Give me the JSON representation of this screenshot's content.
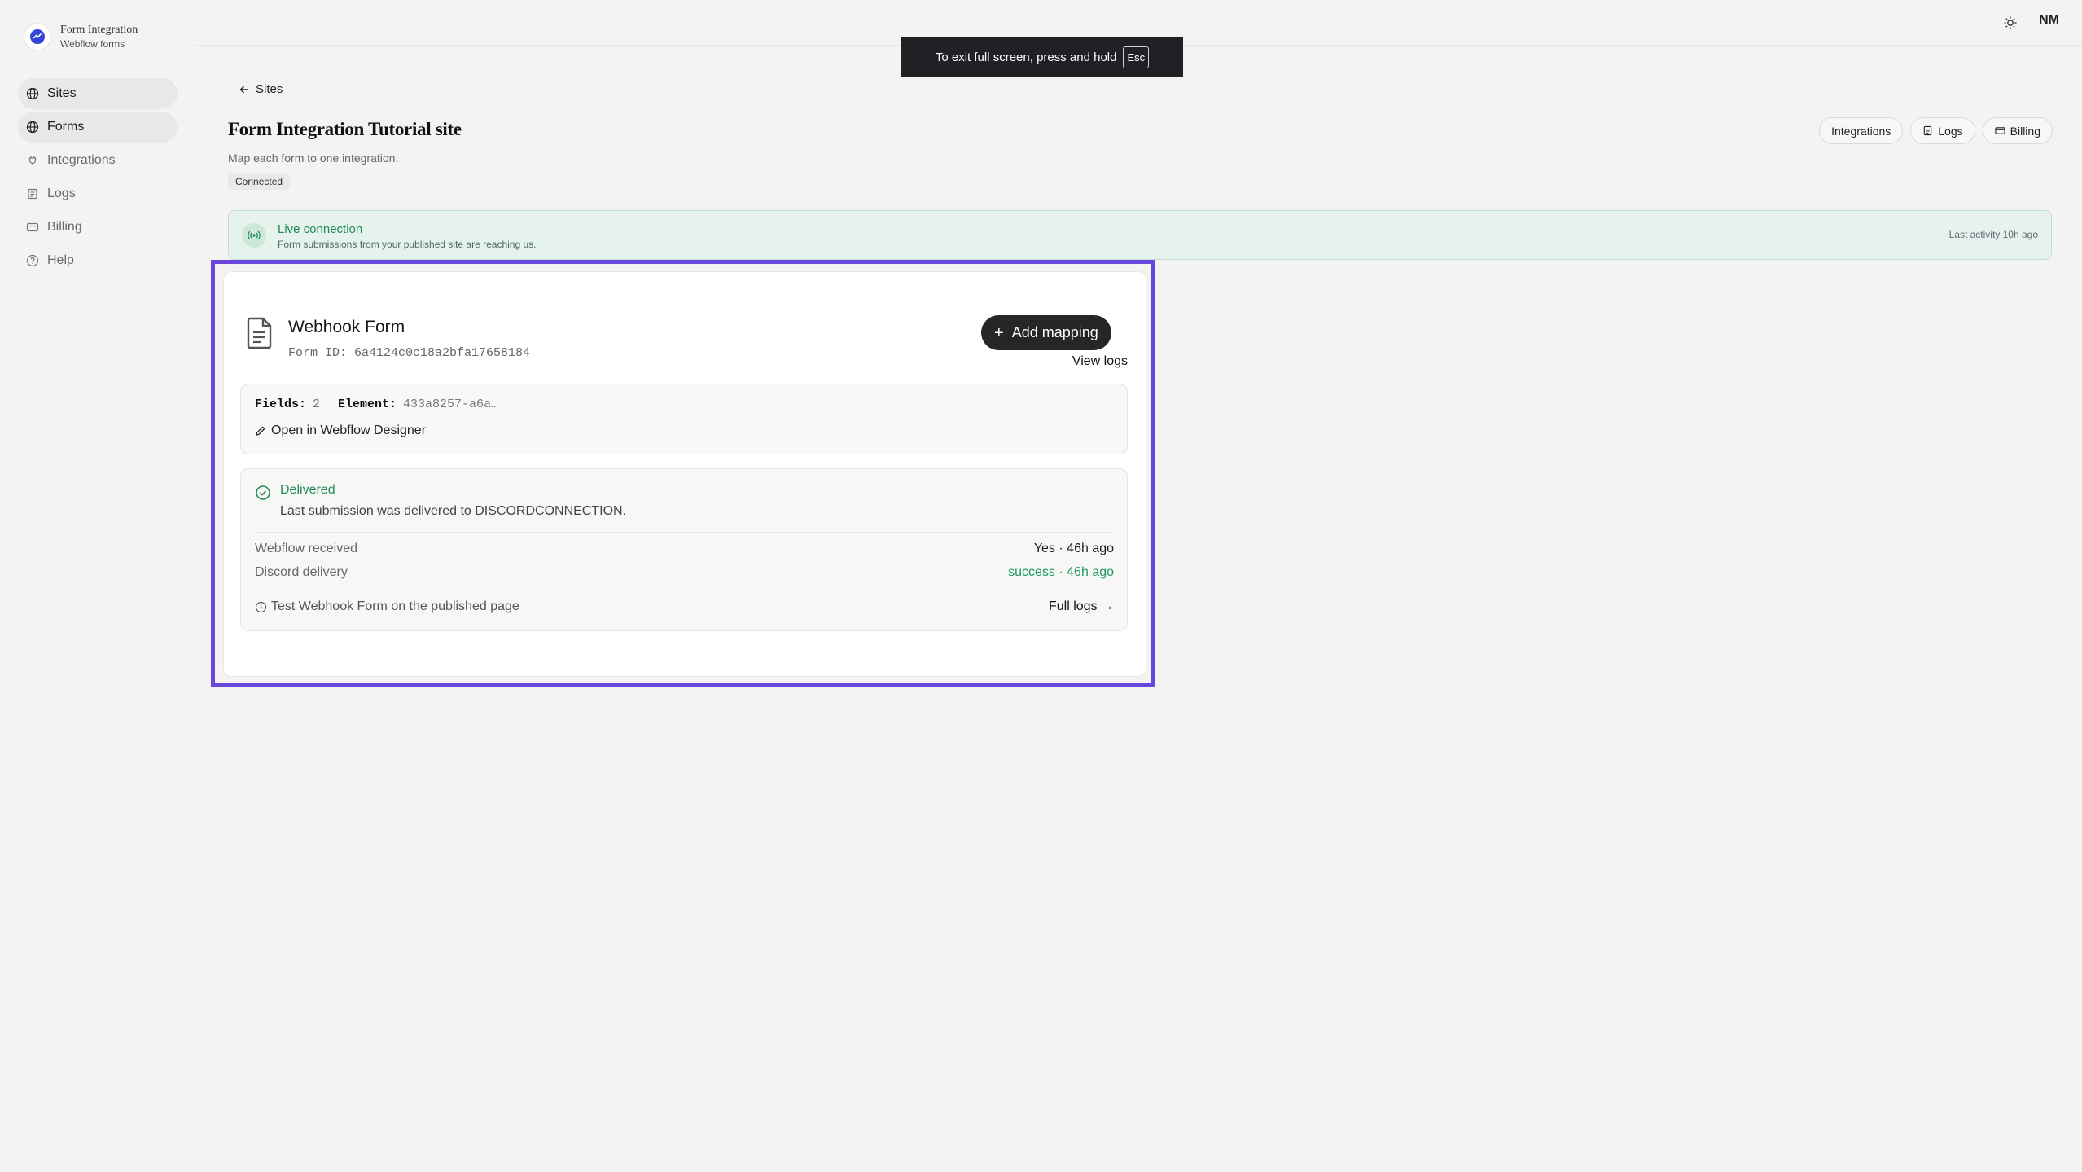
{
  "brand": {
    "title": "Form Integration",
    "subtitle": "Webflow forms"
  },
  "sidebar": {
    "items": [
      {
        "label": "Sites",
        "icon": "globe-icon",
        "active": true
      },
      {
        "label": "Forms",
        "icon": "globe-icon",
        "active": true
      },
      {
        "label": "Integrations",
        "icon": "plug-icon",
        "active": false
      },
      {
        "label": "Logs",
        "icon": "scroll-icon",
        "active": false
      },
      {
        "label": "Billing",
        "icon": "credit-card-icon",
        "active": false
      },
      {
        "label": "Help",
        "icon": "help-circle-icon",
        "active": false
      }
    ]
  },
  "topbar": {
    "avatar_initials": "NM",
    "theme_icon": "sun-icon"
  },
  "fullscreen_toast": {
    "message": "To exit full screen, press and hold",
    "key": "Esc"
  },
  "header": {
    "back_label": "Sites",
    "title": "Form Integration Tutorial site",
    "subtitle": "Map each form to one integration.",
    "status_badge": "Connected",
    "actions": {
      "integrations": "Integrations",
      "logs": "Logs",
      "billing": "Billing"
    }
  },
  "live_banner": {
    "title": "Live connection",
    "subtitle": "Form submissions from your published site are reaching us.",
    "last_activity": "Last activity 10h ago",
    "accent_color": "#1f8a5c"
  },
  "form_card": {
    "name": "Webhook Form",
    "form_id": "Form ID: 6a4124c0c18a2bfa17658184",
    "add_mapping_label": "Add mapping",
    "view_logs_label": "View logs",
    "fields_label": "Fields:",
    "fields_count": "2",
    "element_label": "Element:",
    "element_value": "433a8257-a6a…",
    "designer_link": "Open in Webflow Designer",
    "status": {
      "title": "Delivered",
      "description": "Last submission was delivered to DISCORDCONNECTION.",
      "rows": [
        {
          "label": "Webflow received",
          "value": "Yes · 46h ago"
        },
        {
          "label": "Discord delivery",
          "value": "success · 46h ago"
        }
      ],
      "test_link": "Test Webhook Form on the published page",
      "full_logs_label": "Full logs →"
    }
  },
  "colors": {
    "highlight": "#6a47dc",
    "success": "#1f9a66",
    "dark_button": "#262626"
  }
}
